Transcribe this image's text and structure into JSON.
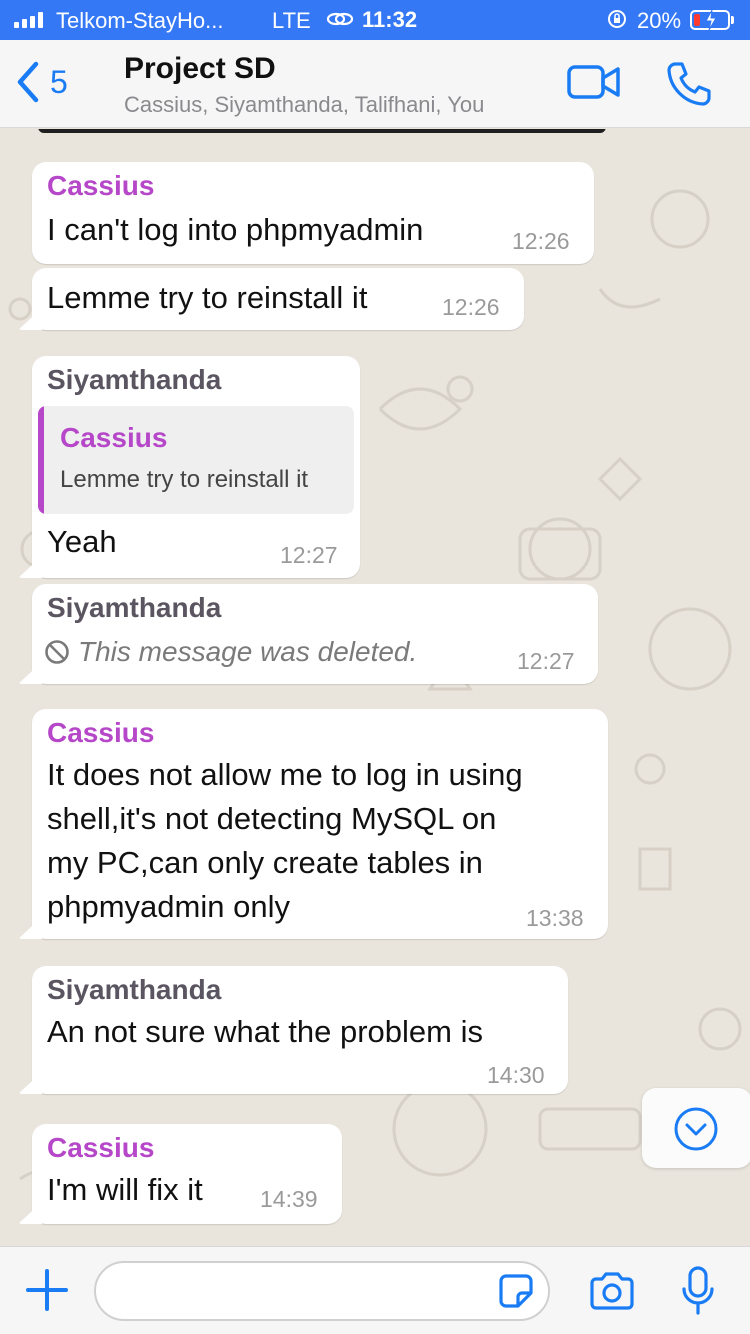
{
  "status_bar": {
    "carrier": "Telkom-StayHo...",
    "network": "LTE",
    "time": "11:32",
    "battery": "20%",
    "battery_color": "#ff3b30",
    "bar_color": "#3478f6"
  },
  "header": {
    "back_count": "5",
    "title": "Project SD",
    "subtitle": "Cassius, Siyamthanda, Talifhani, You",
    "accent_color": "#1a7cf5"
  },
  "messages": [
    {
      "sender": "Cassius",
      "text": "I can't log into phpmyadmin",
      "time": "12:26"
    },
    {
      "sender": "",
      "text": "Lemme try to reinstall it",
      "time": "12:26"
    },
    {
      "sender": "Siyamthanda",
      "quote_sender": "Cassius",
      "quote_text": "Lemme try to reinstall it",
      "text": "Yeah",
      "time": "12:27"
    },
    {
      "sender": "Siyamthanda",
      "text": "This message was deleted.",
      "time": "12:27",
      "deleted": true
    },
    {
      "sender": "Cassius",
      "lines": [
        "It does not allow me to log in using",
        "shell,it's not detecting MySQL on",
        "my PC,can only create tables in",
        "phpmyadmin only"
      ],
      "time": "13:38"
    },
    {
      "sender": "Siyamthanda",
      "text": "An not sure what the problem is",
      "time": "14:30"
    },
    {
      "sender": "Cassius",
      "text": "I'm will fix it",
      "time": "14:39"
    }
  ],
  "sender_colors": {
    "Cassius": "#b547c8",
    "Siyamthanda": "#5a5560"
  },
  "input": {
    "placeholder": ""
  },
  "icons": [
    "back-chevron-icon",
    "video-call-icon",
    "phone-icon",
    "deleted-icon",
    "chevron-down-icon",
    "plus-icon",
    "sticker-icon",
    "camera-icon",
    "microphone-icon"
  ]
}
